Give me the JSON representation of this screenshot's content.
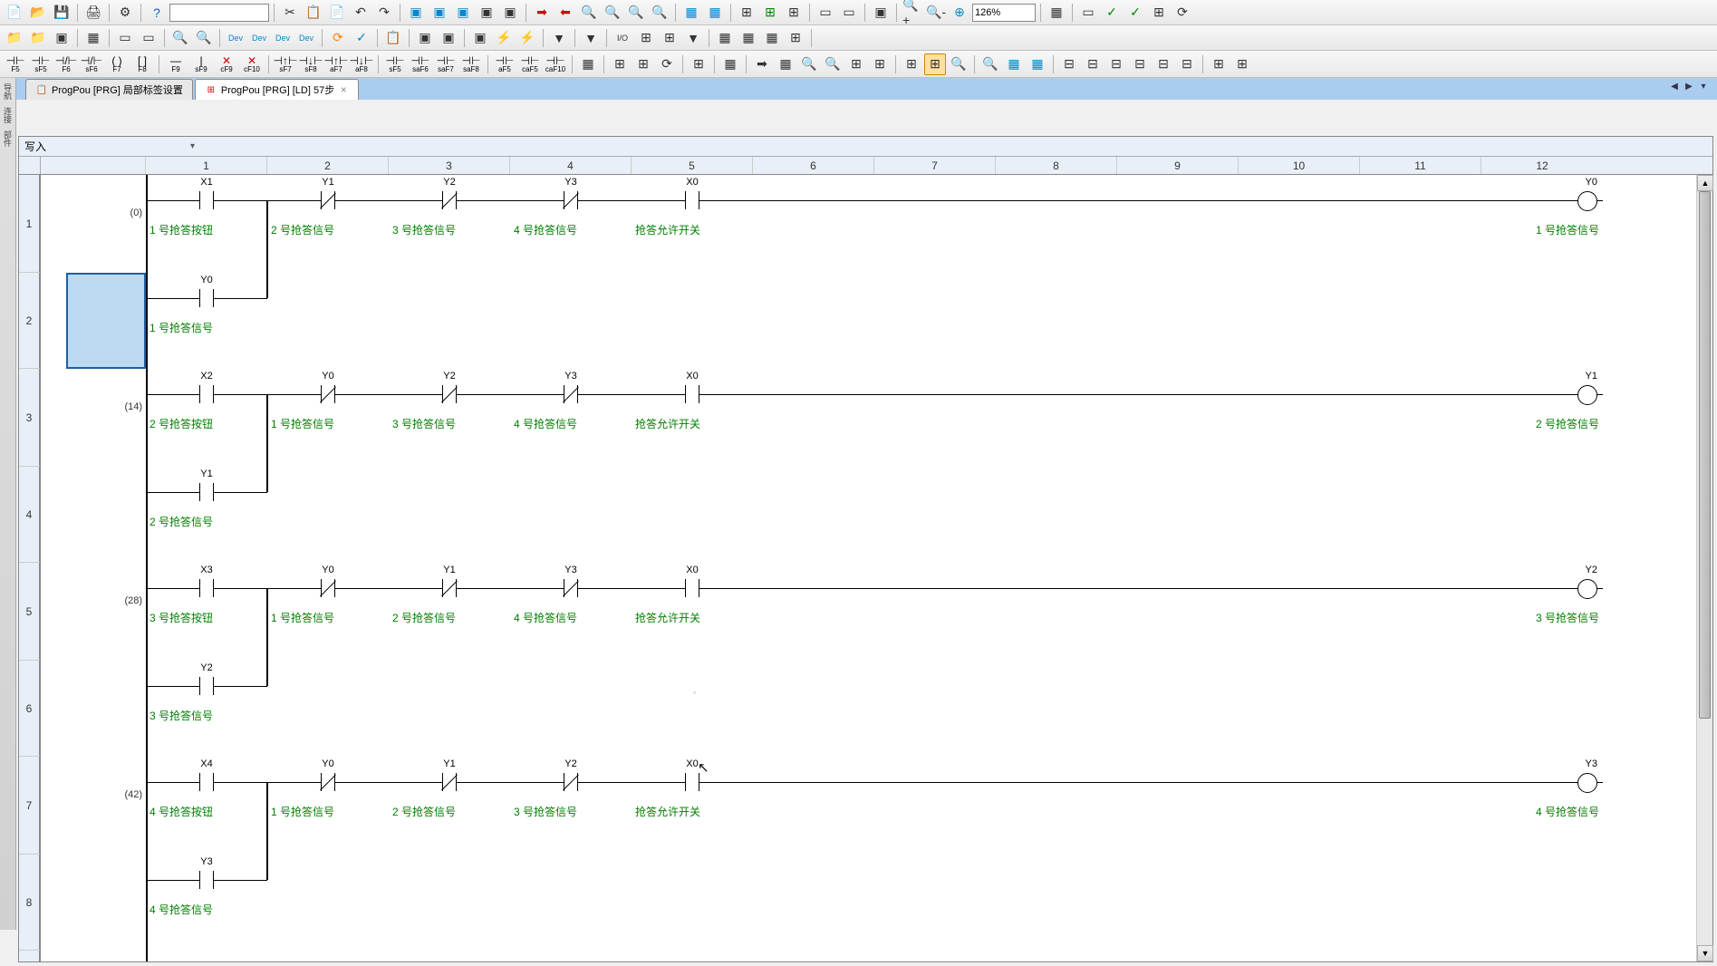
{
  "zoom": "126%",
  "tabs": {
    "tab1": "ProgPou [PRG] 局部标签设置",
    "tab2": "ProgPou [PRG] [LD] 57步"
  },
  "mode": "写入",
  "columns": [
    "1",
    "2",
    "3",
    "4",
    "5",
    "6",
    "7",
    "8",
    "9",
    "10",
    "11",
    "12"
  ],
  "rows": [
    "1",
    "2",
    "3",
    "4",
    "5",
    "6",
    "7",
    "8"
  ],
  "steps": {
    "r1": "(0)",
    "r3": "(14)",
    "r5": "(28)",
    "r7": "(42)"
  },
  "rungs": [
    {
      "row": 1,
      "elements": [
        {
          "col": 1,
          "type": "NO",
          "dev": "X1",
          "cmt": "1 号抢答按钮"
        },
        {
          "col": 2,
          "type": "NC",
          "dev": "Y1",
          "cmt": "2 号抢答信号"
        },
        {
          "col": 3,
          "type": "NC",
          "dev": "Y2",
          "cmt": "3 号抢答信号"
        },
        {
          "col": 4,
          "type": "NC",
          "dev": "Y3",
          "cmt": "4 号抢答信号"
        },
        {
          "col": 5,
          "type": "NO",
          "dev": "X0",
          "cmt": "抢答允许开关"
        },
        {
          "col": 12,
          "type": "COIL",
          "dev": "Y0",
          "cmt": "1 号抢答信号"
        }
      ],
      "branch": {
        "row": 2,
        "col": 1,
        "type": "NO",
        "dev": "Y0",
        "cmt": "1 号抢答信号"
      }
    },
    {
      "row": 3,
      "elements": [
        {
          "col": 1,
          "type": "NO",
          "dev": "X2",
          "cmt": "2 号抢答按钮"
        },
        {
          "col": 2,
          "type": "NC",
          "dev": "Y0",
          "cmt": "1 号抢答信号"
        },
        {
          "col": 3,
          "type": "NC",
          "dev": "Y2",
          "cmt": "3 号抢答信号"
        },
        {
          "col": 4,
          "type": "NC",
          "dev": "Y3",
          "cmt": "4 号抢答信号"
        },
        {
          "col": 5,
          "type": "NO",
          "dev": "X0",
          "cmt": "抢答允许开关"
        },
        {
          "col": 12,
          "type": "COIL",
          "dev": "Y1",
          "cmt": "2 号抢答信号"
        }
      ],
      "branch": {
        "row": 4,
        "col": 1,
        "type": "NO",
        "dev": "Y1",
        "cmt": "2 号抢答信号"
      }
    },
    {
      "row": 5,
      "elements": [
        {
          "col": 1,
          "type": "NO",
          "dev": "X3",
          "cmt": "3 号抢答按钮"
        },
        {
          "col": 2,
          "type": "NC",
          "dev": "Y0",
          "cmt": "1 号抢答信号"
        },
        {
          "col": 3,
          "type": "NC",
          "dev": "Y1",
          "cmt": "2 号抢答信号"
        },
        {
          "col": 4,
          "type": "NC",
          "dev": "Y3",
          "cmt": "4 号抢答信号"
        },
        {
          "col": 5,
          "type": "NO",
          "dev": "X0",
          "cmt": "抢答允许开关"
        },
        {
          "col": 12,
          "type": "COIL",
          "dev": "Y2",
          "cmt": "3 号抢答信号"
        }
      ],
      "branch": {
        "row": 6,
        "col": 1,
        "type": "NO",
        "dev": "Y2",
        "cmt": "3 号抢答信号"
      }
    },
    {
      "row": 7,
      "elements": [
        {
          "col": 1,
          "type": "NO",
          "dev": "X4",
          "cmt": "4 号抢答按钮"
        },
        {
          "col": 2,
          "type": "NC",
          "dev": "Y0",
          "cmt": "1 号抢答信号"
        },
        {
          "col": 3,
          "type": "NC",
          "dev": "Y1",
          "cmt": "2 号抢答信号"
        },
        {
          "col": 4,
          "type": "NC",
          "dev": "Y2",
          "cmt": "3 号抢答信号"
        },
        {
          "col": 5,
          "type": "NO",
          "dev": "X0",
          "cmt": "抢答允许开关"
        },
        {
          "col": 12,
          "type": "COIL",
          "dev": "Y3",
          "cmt": "4 号抢答信号"
        }
      ],
      "branch": {
        "row": 8,
        "col": 1,
        "type": "NO",
        "dev": "Y3",
        "cmt": "4 号抢答信号"
      }
    }
  ],
  "fkeys": {
    "row3": [
      "F5",
      "sF5",
      "F6",
      "sF6",
      "F7",
      "F8",
      "F9",
      "sF9",
      "cF9",
      "cF10",
      "sF7",
      "sF8",
      "aF7",
      "aF8",
      "sF5",
      "saF6",
      "saF7",
      "saF8",
      "aF5",
      "caF5",
      "caF10"
    ]
  }
}
